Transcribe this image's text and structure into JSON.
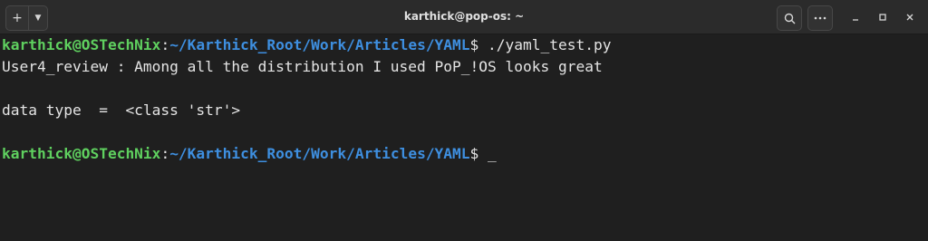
{
  "window": {
    "title": "karthick@pop-os: ~",
    "new_tab_icon": "plus-icon",
    "tab_menu_icon": "chevron-down-icon",
    "search_icon": "search-icon",
    "menu_icon": "ellipsis-icon",
    "minimize_icon": "minimize-icon",
    "maximize_icon": "maximize-icon",
    "close_icon": "close-icon"
  },
  "terminal": {
    "prompt_user_host": "karthick@OSTechNix",
    "prompt_colon": ":",
    "prompt_path": "~/Karthick_Root/Work/Articles/YAML",
    "prompt_dollar": "$",
    "lines": [
      {
        "kind": "prompt",
        "command": " ./yaml_test.py"
      },
      {
        "kind": "output",
        "text": "User4_review : Among all the distribution I used PoP_!OS looks great"
      },
      {
        "kind": "output",
        "text": ""
      },
      {
        "kind": "output",
        "text": "data type  =  <class 'str'>"
      },
      {
        "kind": "output",
        "text": ""
      },
      {
        "kind": "prompt",
        "command": " "
      }
    ],
    "cursor": "_"
  },
  "colors": {
    "background": "#1f1f1f",
    "titlebar": "#2b2b2b",
    "prompt_user": "#5fd05f",
    "prompt_path": "#3e8fe0",
    "text": "#e4e4e4"
  }
}
